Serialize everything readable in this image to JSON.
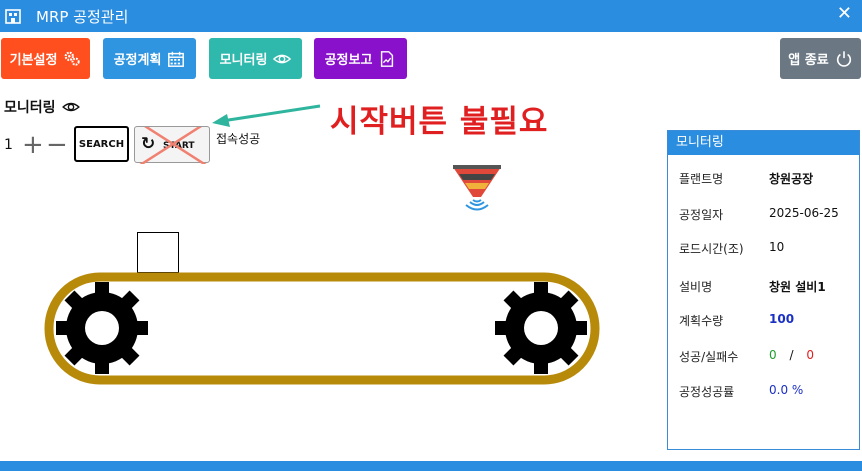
{
  "window": {
    "title": "MRP 공정관리",
    "close_icon": "close-icon"
  },
  "nav": {
    "basic_settings": {
      "label": "기본설정",
      "icon": "gears-icon",
      "color": "#ff4f1f"
    },
    "process_plan": {
      "label": "공정계획",
      "icon": "calendar-icon",
      "color": "#2f95e0"
    },
    "monitoring": {
      "label": "모니터링",
      "icon": "eye-icon",
      "color": "#2fb9ad"
    },
    "process_report": {
      "label": "공정보고",
      "icon": "chart-document-icon",
      "color": "#8a11cc"
    },
    "exit": {
      "label": "앱 종료",
      "icon": "power-icon",
      "color": "#6b7883"
    }
  },
  "main": {
    "section_label": "모니터링",
    "stepper_value": "1",
    "search_label": "SEARCH",
    "start_label": "START",
    "connection_status": "접속성공",
    "annotation": "시작버튼 불필요"
  },
  "panel": {
    "header": "모니터링",
    "rows": [
      {
        "key": "플랜트명",
        "value": "창원공장",
        "bold": true,
        "color": "#111111"
      },
      {
        "key": "공정일자",
        "value": "2025-06-25",
        "bold": false,
        "color": "#111111"
      },
      {
        "key": "로드시간(조)",
        "value": "10",
        "bold": false,
        "color": "#111111"
      },
      {
        "key": "설비명",
        "value": "창원 설비1",
        "bold": true,
        "color": "#111111"
      },
      {
        "key": "계획수량",
        "value": "100",
        "bold": true,
        "color": "#1a2fc4"
      },
      {
        "key": "성공/실패수",
        "success": "0",
        "separator": "/",
        "fail": "0",
        "success_color": "#1e9e2e",
        "fail_color": "#e02020"
      },
      {
        "key": "공정성공률",
        "value": "0.0 %",
        "bold": false,
        "color": "#1a2fc4"
      }
    ]
  }
}
